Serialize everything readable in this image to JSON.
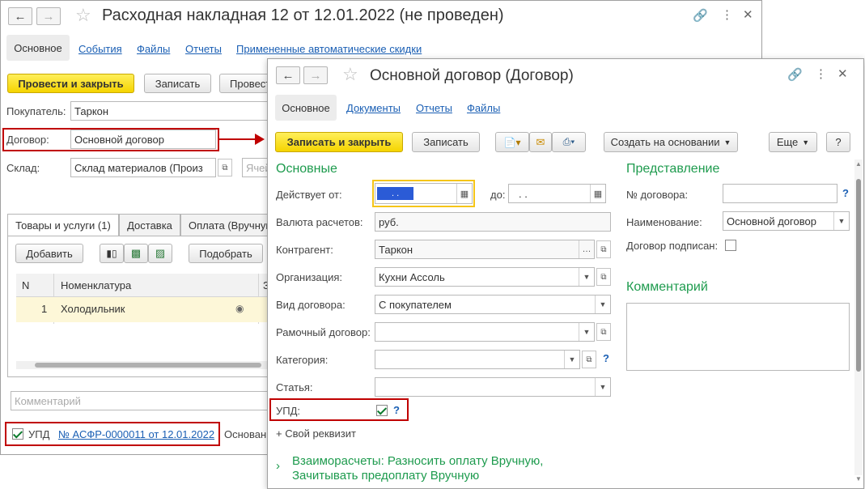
{
  "back_window": {
    "title": "Расходная накладная 12 от 12.01.2022 (не проведен)",
    "tabs": [
      "Основное",
      "События",
      "Файлы",
      "Отчеты",
      "Примененные автоматические скидки"
    ],
    "buttons": {
      "post_close": "Провести и закрыть",
      "save": "Записать",
      "post": "Провести"
    },
    "buyer_label": "Покупатель:",
    "buyer_value": "Таркон",
    "contract_label": "Договор:",
    "contract_value": "Основной договор",
    "warehouse_label": "Склад:",
    "warehouse_value": "Склад материалов (Произ",
    "cell_placeholder": "Ячей",
    "inner_tabs": [
      "Товары и услуги (1)",
      "Доставка",
      "Оплата (Вручную"
    ],
    "add_button": "Добавить",
    "pick_button": "Подобрать",
    "grid_cols": {
      "n": "N",
      "item": "Номенклатура",
      "z": "З"
    },
    "grid_rows": [
      {
        "n": "1",
        "item": "Холодильник"
      }
    ],
    "comment_placeholder": "Комментарий",
    "upd_label": "УПД",
    "upd_link": "№ АСФР-0000011 от 12.01.2022",
    "basis_label": "Основани"
  },
  "front_window": {
    "title": "Основной договор (Договор)",
    "tabs": [
      "Основное",
      "Документы",
      "Отчеты",
      "Файлы"
    ],
    "buttons": {
      "save_close": "Записать и закрыть",
      "save": "Записать",
      "create_based": "Создать на основании",
      "more": "Еще",
      "help": "?"
    },
    "section_main": "Основные",
    "valid_from_label": "Действует от:",
    "valid_from_value": ". .",
    "to_label": "до:",
    "to_value": ". .",
    "currency_label": "Валюта расчетов:",
    "currency_value": "руб.",
    "counterparty_label": "Контрагент:",
    "counterparty_value": "Таркон",
    "org_label": "Организация:",
    "org_value": "Кухни Ассоль",
    "kind_label": "Вид договора:",
    "kind_value": "С покупателем",
    "frame_label": "Рамочный договор:",
    "frame_value": "",
    "category_label": "Категория:",
    "category_value": "",
    "article_label": "Статья:",
    "article_value": "",
    "upd_label": "УПД:",
    "own_prop": "+ Свой реквизит",
    "settlements_line1": "Взаиморасчеты: Разносить оплату Вручную,",
    "settlements_line2": "Зачитывать предоплату Вручную",
    "section_repr": "Представление",
    "contract_no_label": "№ договора:",
    "contract_no_value": "",
    "name_label": "Наименование:",
    "name_value": "Основной договор",
    "signed_label": "Договор подписан:",
    "section_comment": "Комментарий"
  },
  "colors": {
    "accent_green": "#1e9b4e",
    "link_blue": "#1a5fb4",
    "highlight_red": "#c00000",
    "primary_yellow": "#f5d400"
  }
}
